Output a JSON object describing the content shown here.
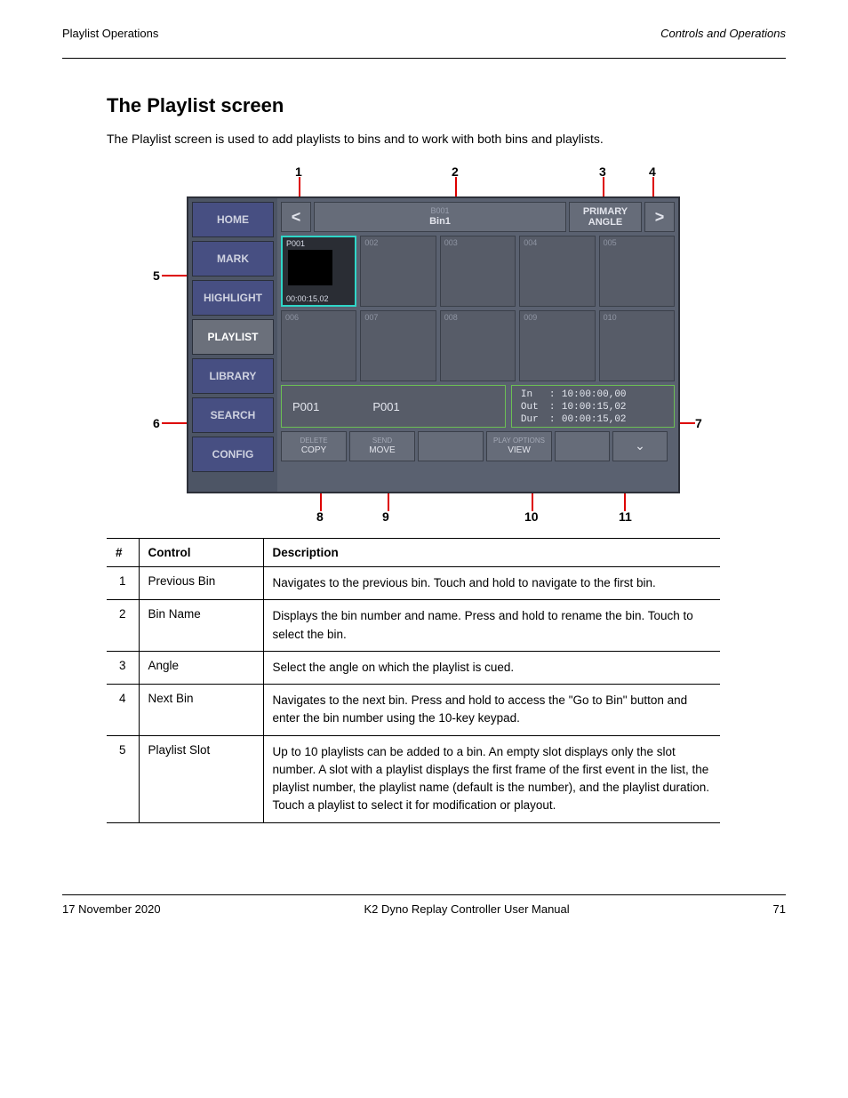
{
  "header": {
    "left": "Playlist Operations",
    "right": "Controls and Operations"
  },
  "section_title": "The Playlist screen",
  "intro": "The Playlist screen is used to add playlists to bins and to work with both bins and playlists.",
  "panel": {
    "sidebar": [
      {
        "label": "HOME",
        "active": false
      },
      {
        "label": "MARK",
        "active": false
      },
      {
        "label": "HIGHLIGHT",
        "active": false
      },
      {
        "label": "PLAYLIST",
        "active": true
      },
      {
        "label": "LIBRARY",
        "active": false
      },
      {
        "label": "SEARCH",
        "active": false
      },
      {
        "label": "CONFIG",
        "active": false
      }
    ],
    "toolbar": {
      "prev": "<",
      "bin_id": "B001",
      "bin_name": "Bin1",
      "angle": "PRIMARY ANGLE",
      "next": ">"
    },
    "slots": [
      {
        "num": "P001",
        "name": "P001",
        "dur": "00:00:15,02",
        "filled": true
      },
      {
        "num": "002"
      },
      {
        "num": "003"
      },
      {
        "num": "004"
      },
      {
        "num": "005"
      },
      {
        "num": "006"
      },
      {
        "num": "007"
      },
      {
        "num": "008"
      },
      {
        "num": "009"
      },
      {
        "num": "010"
      }
    ],
    "plname": {
      "id": "P001",
      "name": "P001"
    },
    "tc": {
      "in_label": "In",
      "in": "10:00:00,00",
      "out_label": "Out",
      "out": "10:00:15,02",
      "dur_label": "Dur",
      "dur": "00:00:15,02"
    },
    "bottom": {
      "b1_top": "DELETE",
      "b1": "COPY",
      "b2_top": "SEND",
      "b2": "MOVE",
      "b3_top": "",
      "b3": "",
      "b4_top": "PLAY OPTIONS",
      "b4": "VIEW",
      "b5": "",
      "b6": "⌄"
    }
  },
  "callouts": {
    "c1": "1",
    "c2": "2",
    "c3": "3",
    "c4": "4",
    "c5": "5",
    "c6": "6",
    "c7": "7",
    "c8": "8",
    "c9": "9",
    "c10": "10",
    "c11": "11"
  },
  "table": {
    "h1": "#",
    "h2": "Control",
    "h3": "Description",
    "rows": [
      {
        "n": "1",
        "c": "Previous Bin",
        "d": "Navigates to the previous bin. Touch and hold to navigate to the first bin."
      },
      {
        "n": "2",
        "c": "Bin Name",
        "d": "Displays the bin number and name. Press and hold to rename the bin. Touch to select the bin."
      },
      {
        "n": "3",
        "c": "Angle",
        "d": "Select the angle on which the playlist is cued."
      },
      {
        "n": "4",
        "c": "Next Bin",
        "d": "Navigates to the next bin. Press and hold to access the \"Go to Bin\" button and enter the bin number using the 10-key keypad."
      },
      {
        "n": "5",
        "c": "Playlist Slot",
        "d": "Up to 10 playlists can be added to a bin. An empty slot displays only the slot number. A slot with a playlist displays the first frame of the first event in the list, the playlist number, the playlist name (default is the number), and the playlist duration. Touch a playlist to select it for modification or playout."
      }
    ]
  },
  "footer": {
    "date": "17 November 2020",
    "prod": "K2 Dyno Replay Controller User Manual",
    "page": "71"
  }
}
